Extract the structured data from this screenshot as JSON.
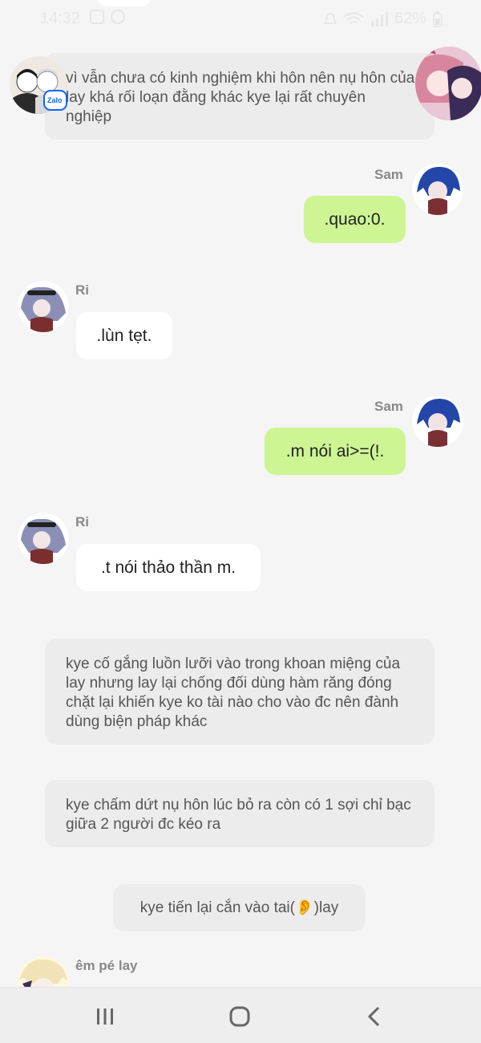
{
  "status_bar": {
    "time": "14:32",
    "battery": "62%"
  },
  "messages": {
    "narration_1": "vì vẫn chưa có kinh nghiệm khi hôn nên nụ hôn của lay khá rối loạn đằng khác kye lại rất chuyên nghiệp",
    "sam_1": {
      "name": "Sam",
      "text": ".quao:0."
    },
    "ri_1": {
      "name": "Ri",
      "text": ".lùn tẹt."
    },
    "sam_2": {
      "name": "Sam",
      "text": ".m nói ai>=(!."
    },
    "ri_2": {
      "name": "Ri",
      "text": ".t nói thảo thần m."
    },
    "narration_2": "kye cố gắng luồn lưỡi vào trong khoan miệng của lay nhưng lay lại chống đối dùng hàm răng đóng chặt lại khiến kye ko tài nào cho vào đc nên đành dùng biện pháp khác",
    "narration_3": "kye chấm dứt nụ hôn lúc bỏ ra còn có 1 sợi chỉ bạc giữa 2 người đc kéo ra",
    "narration_4": "kye tiến lại cắn vào tai(👂)lay",
    "last_sender": {
      "name": "êm pé lay"
    }
  },
  "colors": {
    "background": "#f5f5f5",
    "incoming_bubble": "#ffffff",
    "outgoing_bubble": "#cdf594",
    "narration_bubble": "#ececec"
  },
  "icons": {
    "nav_recents": "recents-icon",
    "nav_home": "home-icon",
    "nav_back": "back-icon"
  }
}
